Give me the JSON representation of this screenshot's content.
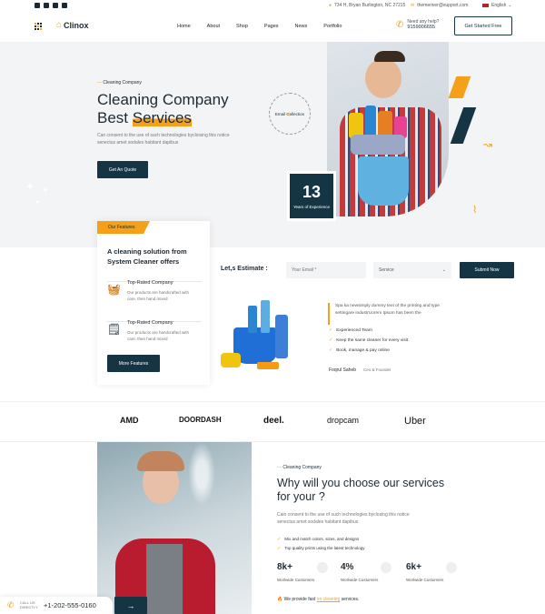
{
  "topbar": {
    "social_icons": [
      "facebook-icon",
      "twitter-icon",
      "instagram-icon",
      "youtube-icon"
    ],
    "address": "734 H, Bryan Burlington, NC 27215",
    "email": "themeriver@support.com",
    "language": "English"
  },
  "header": {
    "brand": "Clinox",
    "nav": [
      "Home",
      "About",
      "Shop",
      "Pages",
      "News",
      "Portfolio"
    ],
    "help_label": "Need any help?",
    "help_phone": "9159006655",
    "cta": "Get Started Free"
  },
  "hero": {
    "eyebrow": "Cleaning Company",
    "title_line1": "Cleaning Company",
    "title_line2_a": "Best ",
    "title_line2_b": "Services",
    "description": "Can consent to the use of such technologies bycloising this notice senectus amet sodales habitant dapibus",
    "button": "Get An Quote",
    "experience_number": "13",
    "experience_label": "Years of Experience",
    "circle_text": "Email Collection"
  },
  "features": {
    "badge": "Our Features",
    "title": "A cleaning solution from System Cleaner offers",
    "items": [
      {
        "title": "Top-Rated Company",
        "text": "Our products are handcrafted with care, then hand mixed"
      },
      {
        "title": "Top-Rated Company",
        "text": "Our products are handcrafted with care, then hand mixed"
      }
    ],
    "button": "More Features"
  },
  "estimate": {
    "label": "Let,s Estimate :",
    "email_placeholder": "Your Email *",
    "service_placeholder": "Service",
    "submit": "Submit Now"
  },
  "about": {
    "text": "Spa ka newsimply dummy text of the printing and type settingare industrUorem Ipsum has been the",
    "checks": [
      "Experienced Team",
      "Keep the same cleaner for every visit",
      "Book, manage & pay online"
    ],
    "author": "Foqrul Saheb",
    "role": "Ceo & Founder"
  },
  "brands": [
    "AMD",
    "DOORDASH",
    "deel.",
    "dropcam",
    "Uber"
  ],
  "why": {
    "eyebrow": "Cleaning Company",
    "title": "Why will you choose our services for your ?",
    "description": "Cain consent to the use of such technologies byclosing this notice senectus amet sodales habitant dapibus",
    "checks": [
      "Mix and match colors, sizes, and designs",
      "Top quality prints using the latest technology"
    ],
    "stats": [
      {
        "value": "8k+",
        "label": "Worlwide Customers"
      },
      {
        "value": "4%",
        "label": "Worlwide Customers"
      },
      {
        "value": "6k+",
        "label": "Worlwide Customers"
      }
    ],
    "fast_text_a": "We provide fast ",
    "fast_text_b": "on cleaning",
    "fast_text_c": " services."
  },
  "call": {
    "label_line1": "CALL US",
    "label_line2": "DIRECTLY",
    "phone": "+1-202-555-0160"
  },
  "colors": {
    "primary": "#163544",
    "accent": "#f4a019"
  }
}
